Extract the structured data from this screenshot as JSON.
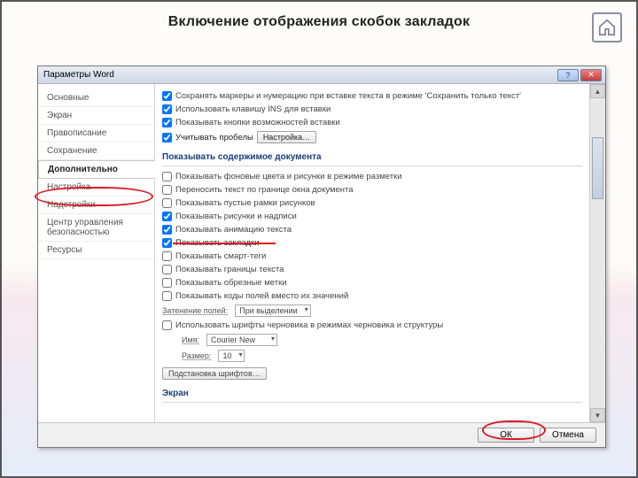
{
  "slide": {
    "title": "Включение отображения скобок закладок"
  },
  "dialog": {
    "title": "Параметры Word",
    "help": "?",
    "close": "✕",
    "sidebar": {
      "items": [
        {
          "label": "Основные"
        },
        {
          "label": "Экран"
        },
        {
          "label": "Правописание"
        },
        {
          "label": "Сохранение"
        },
        {
          "label": "Дополнительно"
        },
        {
          "label": "Настройка"
        },
        {
          "label": "Надстройки"
        },
        {
          "label": "Центр управления безопасностью"
        },
        {
          "label": "Ресурсы"
        }
      ],
      "selected_index": 4
    },
    "content": {
      "top_checks": [
        {
          "checked": true,
          "label": "Сохранять маркеры и нумерацию при вставке текста в режиме 'Сохранить только текст'"
        },
        {
          "checked": true,
          "label": "Использовать клавишу INS для вставки"
        },
        {
          "checked": true,
          "label": "Показывать кнопки возможностей вставки"
        },
        {
          "checked": true,
          "label": "Учитывать пробелы",
          "button": "Настройка…"
        }
      ],
      "section1_title": "Показывать содержимое документа",
      "doc_checks": [
        {
          "checked": false,
          "label": "Показывать фоновые цвета и рисунки в режиме разметки"
        },
        {
          "checked": false,
          "label": "Переносить текст по границе окна документа"
        },
        {
          "checked": false,
          "label": "Показывать пустые рамки рисунков"
        },
        {
          "checked": true,
          "label": "Показывать рисунки и надписи"
        },
        {
          "checked": true,
          "label": "Показывать анимацию текста"
        },
        {
          "checked": true,
          "label": "Показывать закладки"
        },
        {
          "checked": false,
          "label": "Показывать смарт-теги"
        },
        {
          "checked": false,
          "label": "Показывать границы текста"
        },
        {
          "checked": false,
          "label": "Показывать обрезные метки"
        },
        {
          "checked": false,
          "label": "Показывать коды полей вместо их значений"
        }
      ],
      "field_shading": {
        "label": "Затенение полей:",
        "value": "При выделении"
      },
      "draft_font": {
        "checked": false,
        "label": "Использовать шрифты черновика в режимах черновика и структуры"
      },
      "font_name": {
        "label": "Имя:",
        "value": "Courier New"
      },
      "font_size": {
        "label": "Размер:",
        "value": "10"
      },
      "font_subst_btn": "Подстановка шрифтов…",
      "section2_title": "Экран"
    },
    "footer": {
      "ok": "ОК",
      "cancel": "Отмена"
    }
  }
}
